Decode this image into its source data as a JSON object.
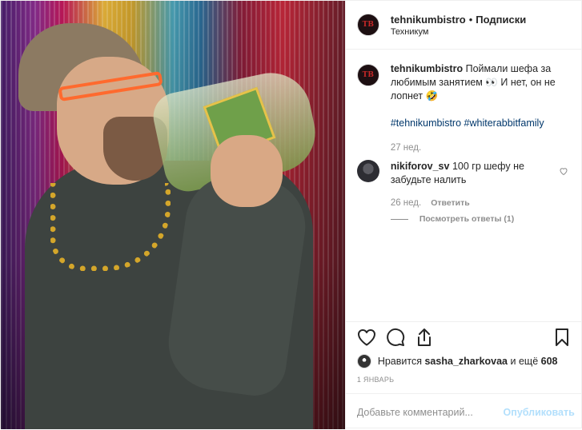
{
  "header": {
    "avatar_text": "TB",
    "username": "tehnikumbistro",
    "separator": "•",
    "follow_label": "Подписки",
    "location": "Техникум"
  },
  "caption": {
    "username": "tehnikumbistro",
    "text": "Поймали шефа за любимым занятием 👀 И нет, он не лопнет 🤣",
    "hashtags": "#tehnikumbistro #whiterabbitfamily",
    "time": "27 нед."
  },
  "comment": {
    "username": "nikiforov_sv",
    "text": "100 гр шефу не забудьте налить",
    "time": "26 нед.",
    "reply_label": "Ответить",
    "view_replies_label": "Посмотреть ответы (1)"
  },
  "likes": {
    "prefix": "Нравится",
    "user": "sasha_zharkovaa",
    "middle": "и ещё",
    "count": "608"
  },
  "date": "1 ЯНВАРЬ",
  "add_comment": {
    "placeholder": "Добавьте комментарий...",
    "publish_label": "Опубликовать"
  },
  "icons": {
    "like": "heart-icon",
    "comment": "speech-bubble-icon",
    "share": "share-icon",
    "save": "bookmark-icon",
    "comment_like": "heart-icon"
  },
  "colors": {
    "link": "#00376b",
    "muted": "#8e8e8e",
    "publish_disabled": "#b2dffc",
    "border": "#efefef"
  }
}
